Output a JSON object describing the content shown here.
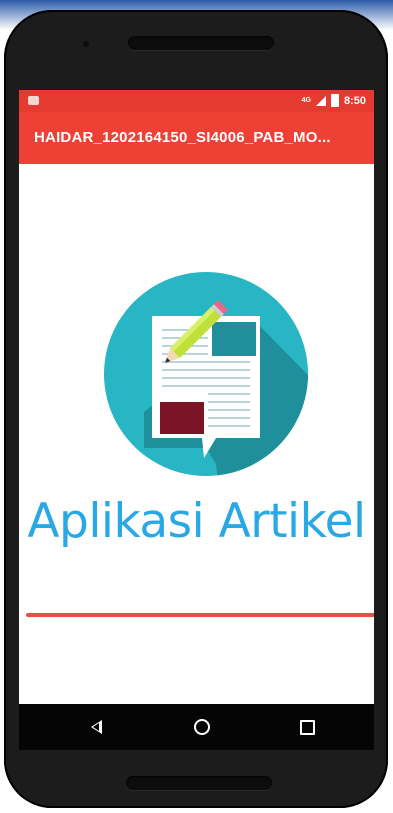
{
  "status_bar": {
    "network_label": "4G",
    "time": "8:50"
  },
  "app_bar": {
    "title": "HAIDAR_1202164150_SI4006_PAB_MO..."
  },
  "main": {
    "headline": "Aplikasi Artikel",
    "logo_icon": "article-edit-logo-icon"
  },
  "colors": {
    "status_bar": "#e53a2f",
    "app_bar": "#ef4035",
    "headline": "#29a8e6",
    "divider": "#ef4d42",
    "logo_circle": "#29b6c4"
  },
  "nav_bar": {
    "back_icon": "back-triangle-icon",
    "home_icon": "home-circle-icon",
    "recents_icon": "recents-square-icon"
  }
}
